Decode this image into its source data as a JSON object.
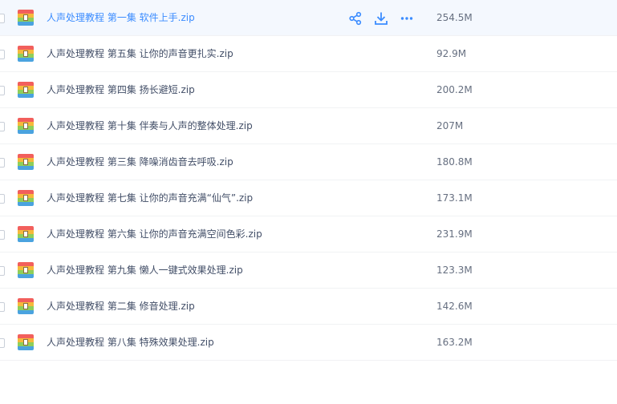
{
  "files": [
    {
      "name": "人声处理教程 第一集 软件上手.zip",
      "size": "254.5M"
    },
    {
      "name": "人声处理教程 第五集 让你的声音更扎实.zip",
      "size": "92.9M"
    },
    {
      "name": "人声处理教程 第四集 扬长避短.zip",
      "size": "200.2M"
    },
    {
      "name": "人声处理教程 第十集 伴奏与人声的整体处理.zip",
      "size": "207M"
    },
    {
      "name": "人声处理教程 第三集 降噪消齿音去呼吸.zip",
      "size": "180.8M"
    },
    {
      "name": "人声处理教程 第七集 让你的声音充满“仙气”.zip",
      "size": "173.1M"
    },
    {
      "name": "人声处理教程 第六集 让你的声音充满空间色彩.zip",
      "size": "231.9M"
    },
    {
      "name": "人声处理教程 第九集 懒人一键式效果处理.zip",
      "size": "123.3M"
    },
    {
      "name": "人声处理教程 第二集 修音处理.zip",
      "size": "142.6M"
    },
    {
      "name": "人声处理教程 第八集 特殊效果处理.zip",
      "size": "163.2M"
    }
  ],
  "hover_actions": {
    "icons": [
      "share-icon",
      "download-icon",
      "more-icon"
    ],
    "color": "#3b8cff"
  },
  "colors": {
    "accent": "#3b8cff",
    "text": "#424e67",
    "hover_row": "#f4f8fe"
  }
}
